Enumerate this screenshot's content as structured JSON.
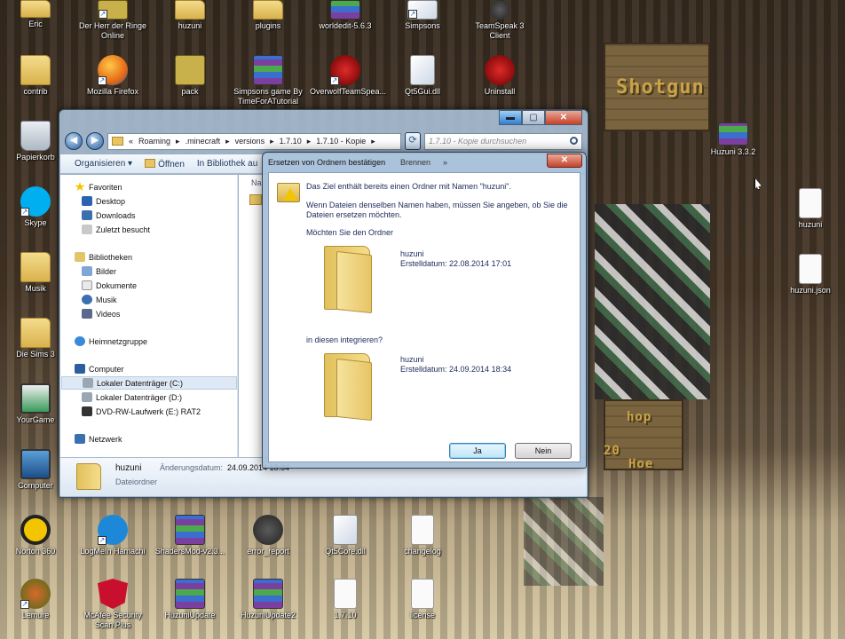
{
  "desktop": {
    "icons": [
      {
        "label": "Eric"
      },
      {
        "label": "Der Herr der Ringe Online"
      },
      {
        "label": "huzuni"
      },
      {
        "label": "plugins"
      },
      {
        "label": "worldedit-5.6.3"
      },
      {
        "label": "Simpsons"
      },
      {
        "label": "TeamSpeak 3 Client"
      },
      {
        "label": "contrib"
      },
      {
        "label": "Mozilla Firefox"
      },
      {
        "label": "pack"
      },
      {
        "label": "Simpsons game By TimeForATutorial"
      },
      {
        "label": "OverwolfTeamSpea..."
      },
      {
        "label": "Qt5Gui.dll"
      },
      {
        "label": "Uninstall"
      },
      {
        "label": "Huzuni 3.3.2"
      },
      {
        "label": "Papierkorb"
      },
      {
        "label": "Skype"
      },
      {
        "label": "huzuni"
      },
      {
        "label": "Musik"
      },
      {
        "label": "huzuni.json"
      },
      {
        "label": "Die Sims 3"
      },
      {
        "label": "YourGame"
      },
      {
        "label": "Computer"
      },
      {
        "label": "Norton 360"
      },
      {
        "label": "LogMeIn Hamachi"
      },
      {
        "label": "ShadersMod-v2.3..."
      },
      {
        "label": "error_report"
      },
      {
        "label": "Qt5Core.dll"
      },
      {
        "label": "changelog"
      },
      {
        "label": "Lemure"
      },
      {
        "label": "McAfee Security Scan Plus"
      },
      {
        "label": "HuzuniUpdate"
      },
      {
        "label": "HuzuniUpdate2"
      },
      {
        "label": "1.7.10"
      },
      {
        "label": "license"
      }
    ],
    "background_signs": [
      "Shotgun",
      "hop",
      "Hoe",
      "20"
    ]
  },
  "explorer": {
    "breadcrumb": [
      "«",
      "Roaming",
      "▸",
      ".minecraft",
      "▸",
      "versions",
      "▸",
      "1.7.10",
      "▸",
      "1.7.10 - Kopie",
      "▸"
    ],
    "search_placeholder": "1.7.10 - Kopie durchsuchen",
    "toolbar": [
      "Organisieren ▾",
      "Öffnen",
      "In Bibliothek au"
    ],
    "column_header_fragment": "Na",
    "nav": [
      {
        "label": "Favoriten",
        "group": true
      },
      {
        "label": "Desktop"
      },
      {
        "label": "Downloads"
      },
      {
        "label": "Zuletzt besucht"
      },
      {
        "label": "Bibliotheken",
        "group": true
      },
      {
        "label": "Bilder"
      },
      {
        "label": "Dokumente"
      },
      {
        "label": "Musik"
      },
      {
        "label": "Videos"
      },
      {
        "label": "Heimnetzgruppe",
        "group": true
      },
      {
        "label": "Computer",
        "group": true
      },
      {
        "label": "Lokaler Datenträger (C:)",
        "selected": true
      },
      {
        "label": "Lokaler Datenträger (D:)"
      },
      {
        "label": "DVD-RW-Laufwerk (E:) RAT2"
      },
      {
        "label": "Netzwerk",
        "group": true
      }
    ],
    "details": {
      "name": "huzuni",
      "type": "Dateiordner",
      "date_label": "Änderungsdatum:",
      "date_value": "24.09.2014 18:34"
    },
    "caption": {
      "min": "▬",
      "max": "▢",
      "close": "✕"
    }
  },
  "dialog": {
    "title": "Ersetzen von Ordnern bestätigen",
    "behind_text": "Brennen",
    "behind_more": "»",
    "close": "✕",
    "line1": "Das Ziel enthält bereits einen Ordner mit Namen \"huzuni\".",
    "line2": "Wenn Dateien denselben Namen haben, müssen Sie angeben, ob Sie die Dateien ersetzen möchten.",
    "question1": "Möchten Sie den Ordner",
    "question2": "in diesen integrieren?",
    "folder1": {
      "name": "huzuni",
      "date": "Erstelldatum: 22.08.2014 17:01"
    },
    "folder2": {
      "name": "huzuni",
      "date": "Erstelldatum: 24.09.2014 18:34"
    },
    "yes": "Ja",
    "no": "Nein"
  }
}
